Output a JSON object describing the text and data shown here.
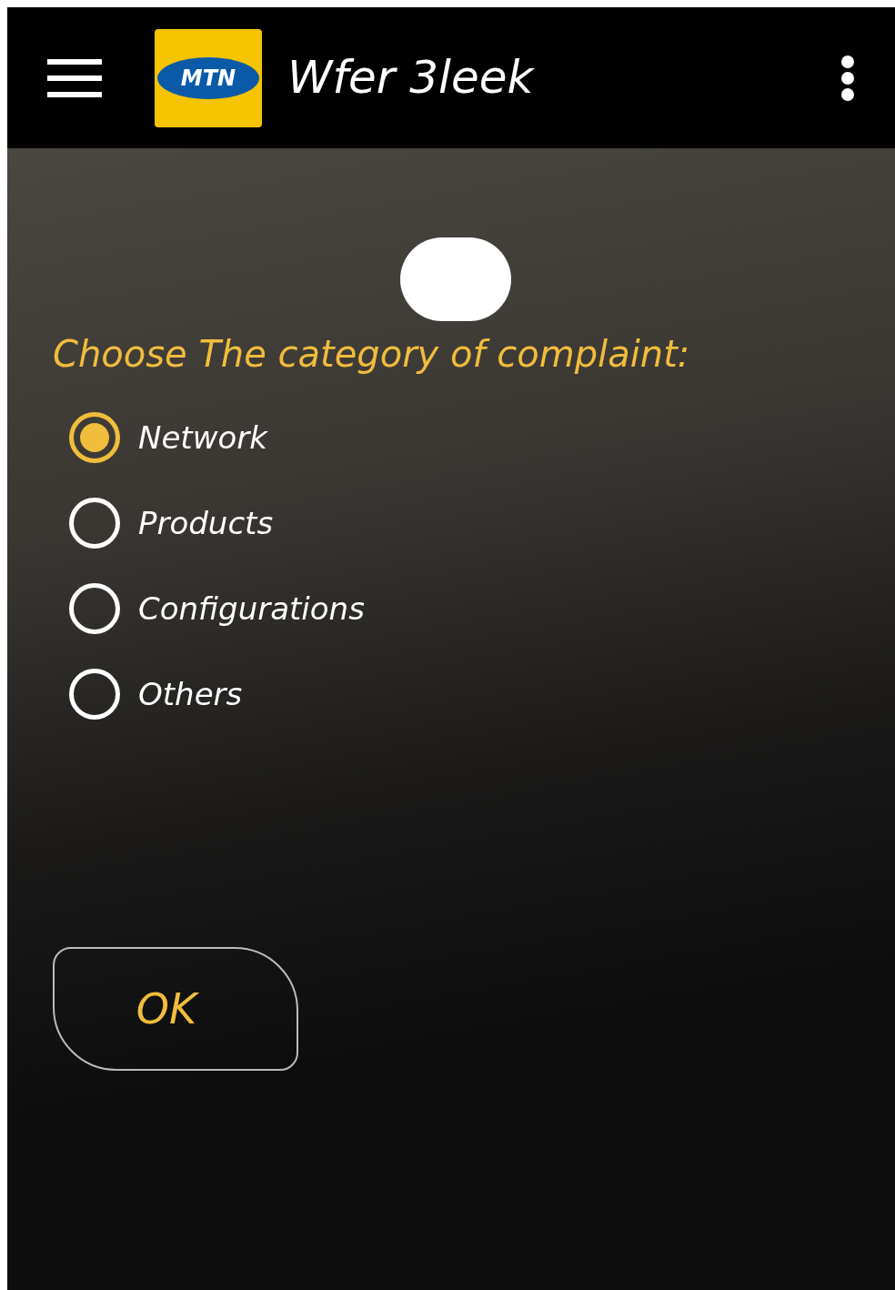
{
  "app_bar": {
    "logo_text": "MTN",
    "title": "Wfer 3leek"
  },
  "question": "Choose The category of complaint:",
  "options": [
    {
      "label": "Network",
      "selected": true
    },
    {
      "label": "Products",
      "selected": false
    },
    {
      "label": "Configurations",
      "selected": false
    },
    {
      "label": "Others",
      "selected": false
    }
  ],
  "ok_button": "OK"
}
